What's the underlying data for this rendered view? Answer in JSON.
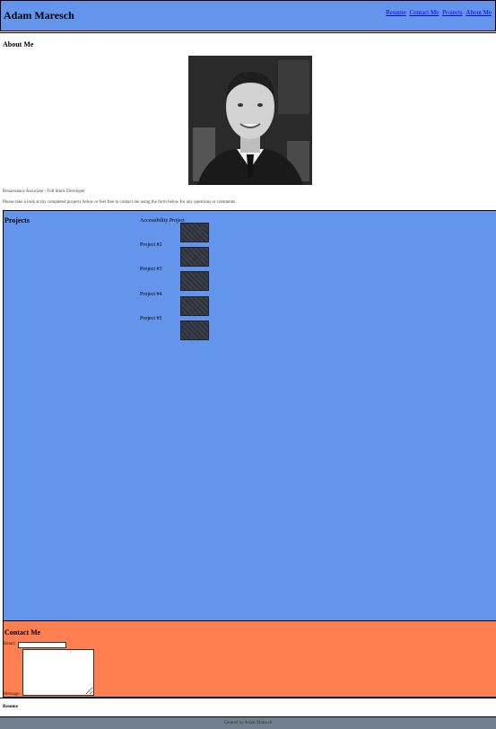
{
  "header": {
    "title": "Adam Maresch",
    "nav": [
      "Resume",
      "Contact Me",
      "Projects",
      "About Me"
    ]
  },
  "about": {
    "heading": "About Me",
    "role": "Renaissance Associate - Full Stack Developer",
    "intro": "Please take a look at my completed projects below or feel free to contact me using the form below for any questions or comments."
  },
  "projects": {
    "heading": "Projects",
    "items": [
      "Accessibility Project",
      "Project #2",
      "Project #3",
      "Project #4",
      "Project #5"
    ]
  },
  "contact": {
    "heading": "Contact Me",
    "email_label": "Email:",
    "email_value": "",
    "message_label": "Message:",
    "message_value": ""
  },
  "resume": {
    "heading": "Resume"
  },
  "footer": {
    "text": "Created by Adam Maresch"
  },
  "colors": {
    "header": "#6495ed",
    "projects": "#6495ed",
    "contact": "#ff7f50",
    "footer": "#708090"
  }
}
